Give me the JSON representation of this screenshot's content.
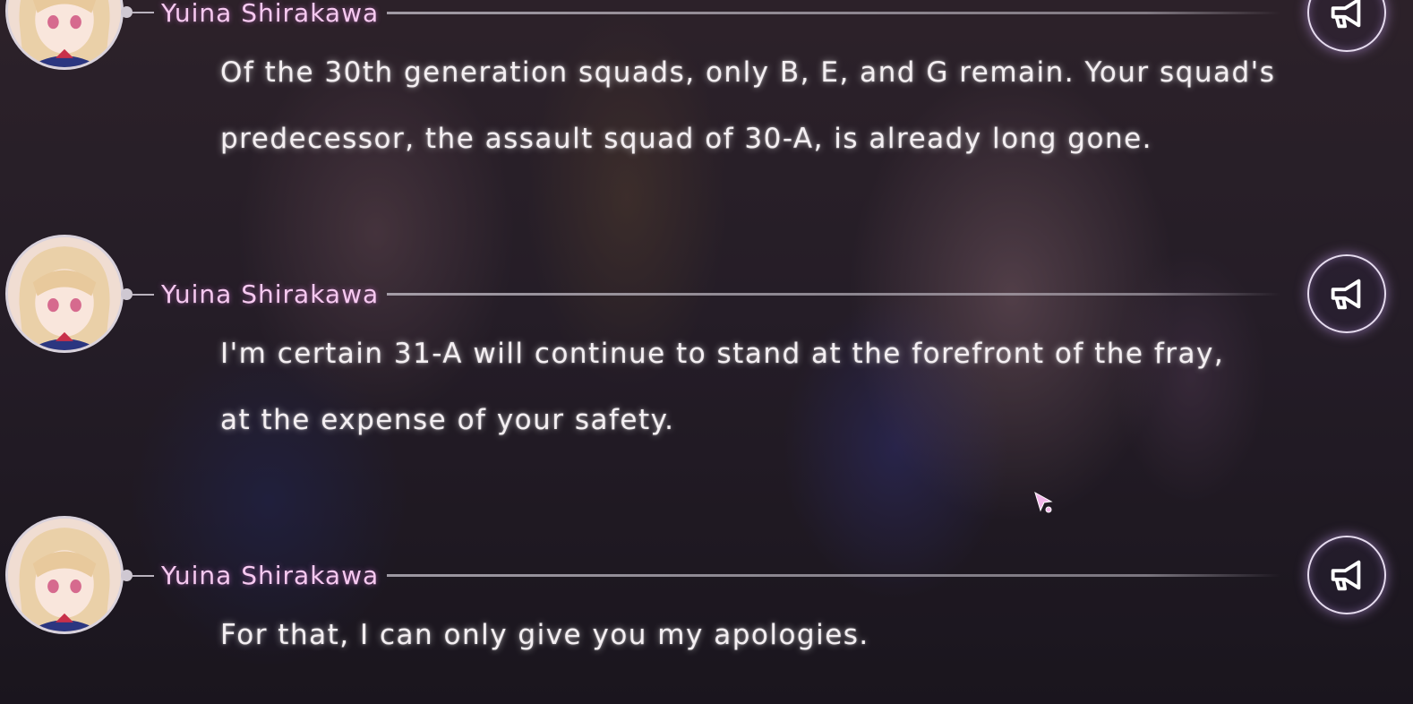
{
  "backlog": {
    "entries": [
      {
        "speaker": "Yuina Shirakawa",
        "line1": "Of the 30th generation squads, only B, E, and G remain. Your squad's",
        "line2": "predecessor, the assault squad of 30-A, is already long gone.",
        "voice_icon": "megaphone-icon"
      },
      {
        "speaker": "Yuina Shirakawa",
        "line1": "I'm certain 31-A will continue to stand at the forefront of the fray,",
        "line2": "at the expense of your safety.",
        "voice_icon": "megaphone-icon"
      },
      {
        "speaker": "Yuina Shirakawa",
        "line1": "For that, I can only give you my apologies.",
        "line2": "",
        "voice_icon": "megaphone-icon"
      }
    ]
  },
  "colors": {
    "speaker_name": "#f6c9f0",
    "dialogue_text": "#f4eff2",
    "accent_glow": "#d2aaff",
    "cursor": "#f3b6ea"
  },
  "cursor_icon": "pointer-cursor-icon"
}
